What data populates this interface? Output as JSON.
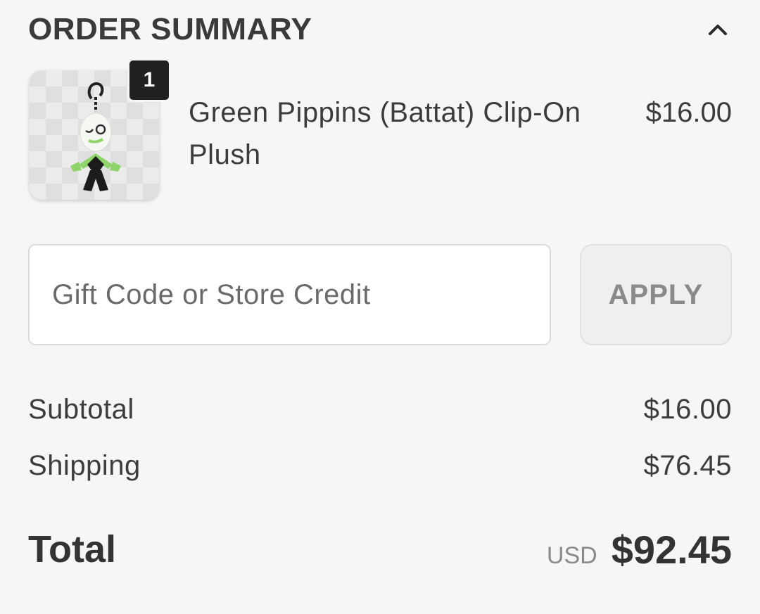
{
  "header": {
    "title": "ORDER SUMMARY",
    "toggle_icon": "chevron-up-icon"
  },
  "item": {
    "quantity": "1",
    "name": "Green Pippins (Battat) Clip-On Plush",
    "price": "$16.00",
    "image_icon": "plush-keychain-image"
  },
  "discount": {
    "placeholder": "Gift Code or Store Credit",
    "value": "",
    "apply_label": "APPLY"
  },
  "summary": {
    "subtotal_label": "Subtotal",
    "subtotal_value": "$16.00",
    "shipping_label": "Shipping",
    "shipping_value": "$76.45",
    "total_label": "Total",
    "currency": "USD",
    "total_value": "$92.45"
  },
  "colors": {
    "background": "#f6f6f6",
    "text": "#3c3c3c",
    "badge": "#202020",
    "plush_green": "#8fd46a"
  }
}
